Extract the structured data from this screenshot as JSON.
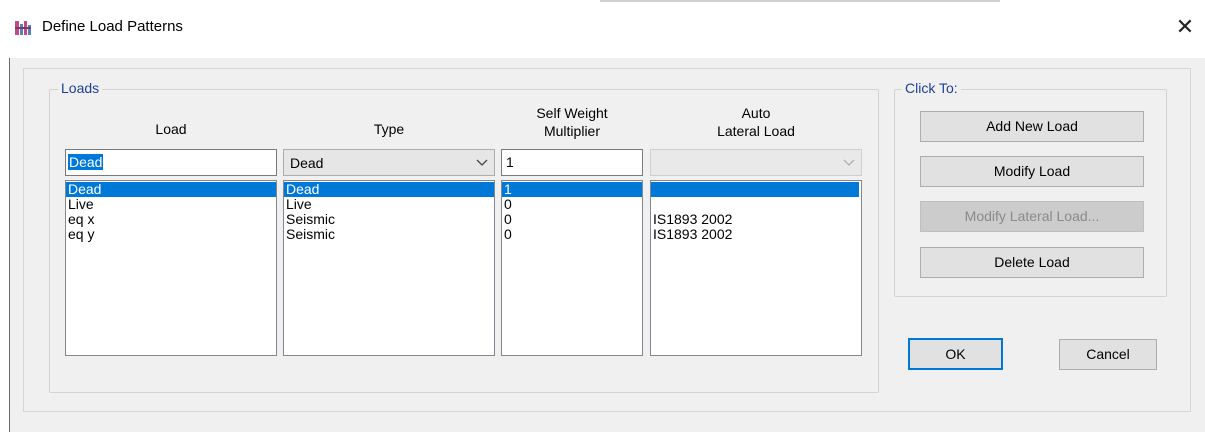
{
  "window": {
    "title": "Define Load Patterns",
    "close_glyph": "✕",
    "icon": "app-icon"
  },
  "loads_group": {
    "legend": "Loads",
    "headers": {
      "load": "Load",
      "type": "Type",
      "swm_line1": "Self Weight",
      "swm_line2": "Multiplier",
      "auto_line1": "Auto",
      "auto_line2": "Lateral Load"
    },
    "load_name_value": "Dead",
    "type_value": "Dead",
    "swm_value": "1",
    "auto_value": "",
    "load_list": [
      "Dead",
      "Live",
      "eq x",
      "eq y"
    ],
    "type_list": [
      "Dead",
      "Live",
      "Seismic",
      "Seismic"
    ],
    "swm_list": [
      "1",
      "0",
      "0",
      "0"
    ],
    "auto_list": [
      "",
      "",
      "IS1893 2002",
      "IS1893 2002"
    ],
    "selected_index": 0
  },
  "click_to_group": {
    "legend": "Click To:",
    "add": "Add New Load",
    "modify": "Modify Load",
    "modify_lateral": "Modify Lateral Load...",
    "delete": "Delete Load"
  },
  "footer": {
    "ok": "OK",
    "cancel": "Cancel"
  },
  "colors": {
    "selection": "#0078d7",
    "legend_text": "#1f3f9a",
    "dialog_bg": "#f0f0f0"
  }
}
